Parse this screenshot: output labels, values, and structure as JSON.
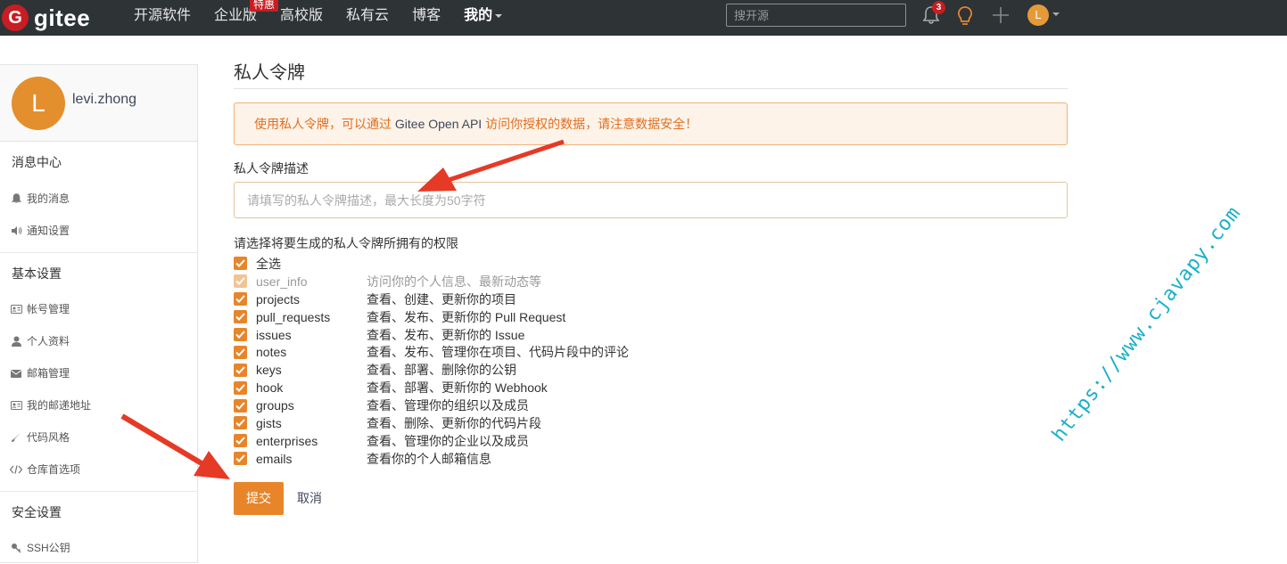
{
  "nav": {
    "logo_text": "gitee",
    "logo_letter": "G",
    "links": [
      "开源软件",
      "企业版",
      "高校版",
      "私有云",
      "博客"
    ],
    "enterprise_badge": "特惠",
    "mine": "我的",
    "search_placeholder": "搜开源",
    "notification_count": "3",
    "avatar_letter": "L",
    "icons": [
      "bell-icon",
      "bulb-icon",
      "plus-icon"
    ]
  },
  "sidebar": {
    "avatar_letter": "L",
    "username": "levi.zhong",
    "sections": [
      {
        "title": "消息中心",
        "items": [
          {
            "label": "我的消息",
            "icon": "bell-icon"
          },
          {
            "label": "通知设置",
            "icon": "speaker-icon"
          }
        ]
      },
      {
        "title": "基本设置",
        "items": [
          {
            "label": "帐号管理",
            "icon": "id-card-icon"
          },
          {
            "label": "个人资料",
            "icon": "user-icon"
          },
          {
            "label": "邮箱管理",
            "icon": "envelope-icon"
          },
          {
            "label": "我的邮递地址",
            "icon": "address-card-icon"
          },
          {
            "label": "代码风格",
            "icon": "brush-icon"
          },
          {
            "label": "仓库首选项",
            "icon": "code-icon"
          }
        ]
      },
      {
        "title": "安全设置",
        "items": [
          {
            "label": "SSH公钥",
            "icon": "key-icon"
          }
        ]
      }
    ]
  },
  "main": {
    "title": "私人令牌",
    "notice_prefix": "使用私人令牌，可以通过 ",
    "notice_api": "Gitee Open API",
    "notice_suffix": " 访问你授权的数据，请注意数据安全！",
    "desc_label": "私人令牌描述",
    "desc_placeholder": "请填写的私人令牌描述，最大长度为50字符",
    "perm_title": "请选择将要生成的私人令牌所拥有的权限",
    "select_all": "全选",
    "permissions": [
      {
        "name": "user_info",
        "desc": "访问你的个人信息、最新动态等",
        "disabled": true
      },
      {
        "name": "projects",
        "desc": "查看、创建、更新你的项目"
      },
      {
        "name": "pull_requests",
        "desc": "查看、发布、更新你的 Pull Request"
      },
      {
        "name": "issues",
        "desc": "查看、发布、更新你的 Issue"
      },
      {
        "name": "notes",
        "desc": "查看、发布、管理你在项目、代码片段中的评论"
      },
      {
        "name": "keys",
        "desc": "查看、部署、删除你的公钥"
      },
      {
        "name": "hook",
        "desc": "查看、部署、更新你的 Webhook"
      },
      {
        "name": "groups",
        "desc": "查看、管理你的组织以及成员"
      },
      {
        "name": "gists",
        "desc": "查看、删除、更新你的代码片段"
      },
      {
        "name": "enterprises",
        "desc": "查看、管理你的企业以及成员"
      },
      {
        "name": "emails",
        "desc": "查看你的个人邮箱信息"
      }
    ],
    "submit": "提交",
    "cancel": "取消"
  },
  "watermark": "https://www.cjavapy.com",
  "colors": {
    "accent": "#e8852a",
    "nav_bg": "#2e3336",
    "brand": "#c71d23",
    "arrow": "#e53a26"
  }
}
